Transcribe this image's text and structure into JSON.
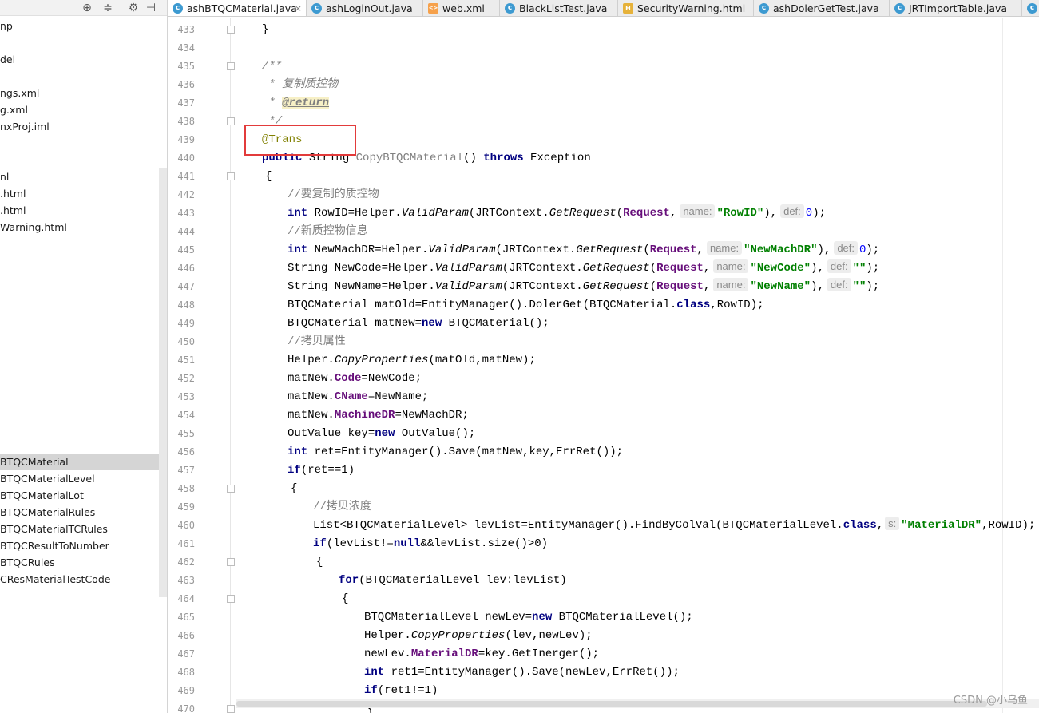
{
  "project_panel": {
    "toolbar": [
      "crosshair-icon",
      "collapse-icon",
      "gear-icon",
      "hide-icon"
    ],
    "tree_items": [
      {
        "label": "np"
      },
      {
        "label": "del"
      },
      {
        "label": "ngs.xml"
      },
      {
        "label": "g.xml"
      },
      {
        "label": "nxProj.iml"
      },
      {
        "label": "nl"
      },
      {
        "label": ".html"
      },
      {
        "label": ".html"
      },
      {
        "label": "Warning.html"
      },
      {
        "label": "BTQCMaterial",
        "selected": true
      },
      {
        "label": "BTQCMaterialLevel"
      },
      {
        "label": "BTQCMaterialLot"
      },
      {
        "label": "BTQCMaterialRules"
      },
      {
        "label": "BTQCMaterialTCRules"
      },
      {
        "label": "BTQCResultToNumber"
      },
      {
        "label": "BTQCRules"
      },
      {
        "label": "CResMaterialTestCode"
      }
    ]
  },
  "tabs": [
    {
      "label": "ashBTQCMaterial.java",
      "icon": "java-class-icon",
      "active": true,
      "close": "×"
    },
    {
      "label": "ashLoginOut.java",
      "icon": "java-class-icon"
    },
    {
      "label": "web.xml",
      "icon": "xml-file-icon"
    },
    {
      "label": "BlackListTest.java",
      "icon": "java-class-icon"
    },
    {
      "label": "SecurityWarning.html",
      "icon": "html-file-icon"
    },
    {
      "label": "ashDolerGetTest.java",
      "icon": "java-class-icon"
    },
    {
      "label": "JRTImportTable.java",
      "icon": "java-class-icon"
    }
  ],
  "editor": {
    "line_numbers": [
      "433",
      "434",
      "435",
      "436",
      "437",
      "438",
      "439",
      "440",
      "441",
      "442",
      "443",
      "444",
      "445",
      "446",
      "447",
      "448",
      "449",
      "450",
      "451",
      "452",
      "453",
      "454",
      "455",
      "456",
      "457",
      "458",
      "459",
      "460",
      "461",
      "462",
      "463",
      "464",
      "465",
      "466",
      "467",
      "468",
      "469",
      "470"
    ],
    "code": {
      "l433": "}",
      "l435": "/**",
      "l436": " * 复制质控物",
      "l437a": " * ",
      "l437b": "@return",
      "l438": " */",
      "l439": "@Trans",
      "l440a": "public",
      "l440b": " String ",
      "l440c": "CopyBTQCMaterial",
      "l440d": "() ",
      "l440e": "throws",
      "l440f": " Exception",
      "l441": "{",
      "l442": "//要复制的质控物",
      "l443a": "int",
      "l443b": " RowID=Helper.",
      "l443c": "ValidParam",
      "l443d": "(JRTContext.",
      "l443e": "GetRequest",
      "l443f": "(",
      "l443g": "Request",
      "l443h": ",",
      "l443i": "name:",
      "l443j": "\"RowID\"",
      "l443k": "),",
      "l443l": "def:",
      "l443m": "0",
      "l443n": ");",
      "l444": "//新质控物信息",
      "l445a": "int",
      "l445b": " NewMachDR=Helper.",
      "l445c": "ValidParam",
      "l445d": "(JRTContext.",
      "l445e": "GetRequest",
      "l445f": "(",
      "l445g": "Request",
      "l445h": ",",
      "l445i": "name:",
      "l445j": "\"NewMachDR\"",
      "l445k": "),",
      "l445l": "def:",
      "l445m": "0",
      "l445n": ");",
      "l446a": "String NewCode=Helper.",
      "l446b": "ValidParam",
      "l446c": "(JRTContext.",
      "l446d": "GetRequest",
      "l446e": "(",
      "l446f": "Request",
      "l446g": ",",
      "l446h": "name:",
      "l446i": "\"NewCode\"",
      "l446j": "),",
      "l446k": "def:",
      "l446l": "\"\"",
      "l446m": ");",
      "l447a": "String NewName=Helper.",
      "l447b": "ValidParam",
      "l447c": "(JRTContext.",
      "l447d": "GetRequest",
      "l447e": "(",
      "l447f": "Request",
      "l447g": ",",
      "l447h": "name:",
      "l447i": "\"NewName\"",
      "l447j": "),",
      "l447k": "def:",
      "l447l": "\"\"",
      "l447m": ");",
      "l448a": "BTQCMaterial matOld=EntityManager().DolerGet(BTQCMaterial.",
      "l448b": "class",
      "l448c": ",RowID);",
      "l449a": "BTQCMaterial matNew=",
      "l449b": "new",
      "l449c": " BTQCMaterial();",
      "l450": "//拷贝属性",
      "l451a": "Helper.",
      "l451b": "CopyProperties",
      "l451c": "(matOld,matNew);",
      "l452a": "matNew.",
      "l452b": "Code",
      "l452c": "=NewCode;",
      "l453a": "matNew.",
      "l453b": "CName",
      "l453c": "=NewName;",
      "l454a": "matNew.",
      "l454b": "MachineDR",
      "l454c": "=NewMachDR;",
      "l455a": "OutValue key=",
      "l455b": "new",
      "l455c": " OutValue();",
      "l456a": "int",
      "l456b": " ret=EntityManager().Save(matNew,key,ErrRet());",
      "l457a": "if",
      "l457b": "(ret==1)",
      "l458": "{",
      "l459": "//拷贝浓度",
      "l460a": "List<BTQCMaterialLevel> levList=EntityManager().FindByColVal(BTQCMaterialLevel.",
      "l460b": "class",
      "l460c": ",",
      "l460d": "s:",
      "l460e": "\"MaterialDR\"",
      "l460f": ",RowID);",
      "l461a": "if",
      "l461b": "(levList!=",
      "l461c": "null",
      "l461d": "&&levList.size()>0)",
      "l462": "{",
      "l463a": "for",
      "l463b": "(BTQCMaterialLevel lev:levList)",
      "l464": "{",
      "l465a": "BTQCMaterialLevel newLev=",
      "l465b": "new",
      "l465c": " BTQCMaterialLevel();",
      "l466a": "Helper.",
      "l466b": "CopyProperties",
      "l466c": "(lev,newLev);",
      "l467a": "newLev.",
      "l467b": "MaterialDR",
      "l467c": "=key.GetInerger();",
      "l468a": "int",
      "l468b": " ret1=EntityManager().Save(newLev,ErrRet());",
      "l469a": "if",
      "l469b": "(ret1!=1)",
      "l470": "{"
    }
  },
  "watermark": "CSDN @小乌鱼",
  "colors": {
    "keyword": "#000080",
    "string": "#008000",
    "field": "#660e7a",
    "comment": "#808080",
    "annotation": "#808000",
    "highlight_box": "#e23b3b"
  }
}
